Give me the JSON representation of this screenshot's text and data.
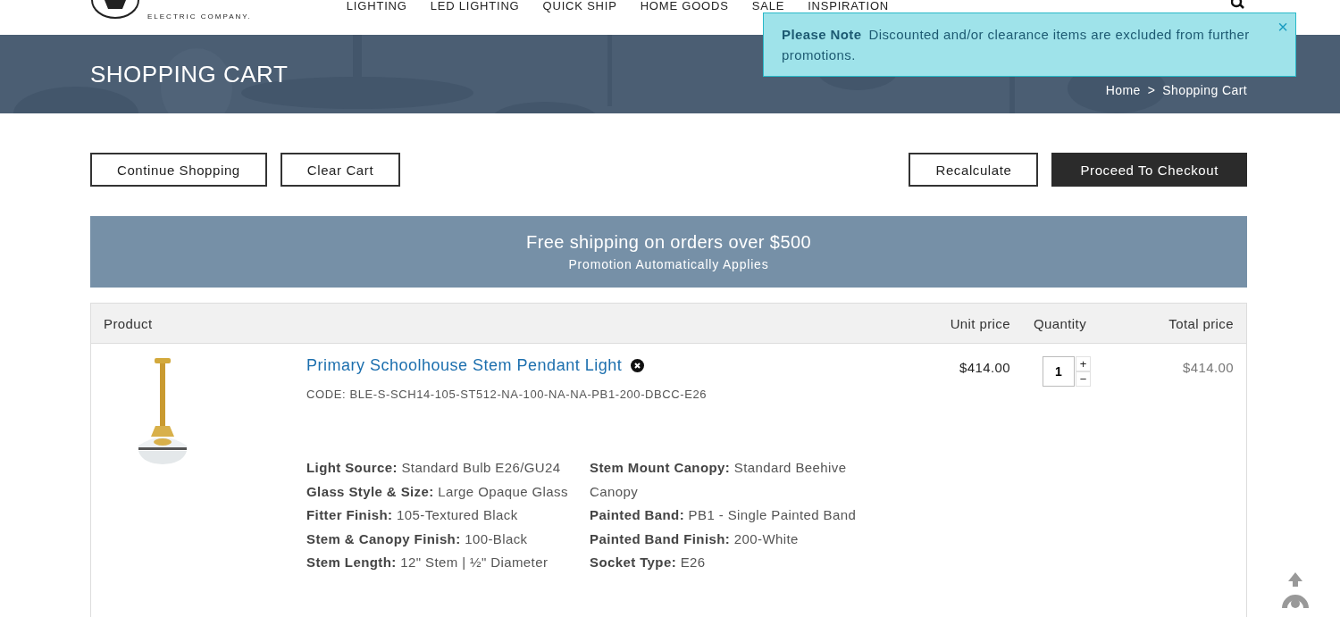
{
  "header": {
    "logo_tagline": "ELECTRIC COMPANY.",
    "nav": [
      {
        "label": "LIGHTING"
      },
      {
        "label": "LED LIGHTING"
      },
      {
        "label": "QUICK SHIP"
      },
      {
        "label": "HOME GOODS"
      },
      {
        "label": "SALE"
      },
      {
        "label": "INSPIRATION"
      }
    ]
  },
  "notice": {
    "title": "Please Note",
    "message": "Discounted and/or clearance items are excluded from further promotions.",
    "close": "×"
  },
  "banner": {
    "title": "SHOPPING CART",
    "breadcrumb": [
      "Home",
      "Shopping Cart"
    ],
    "separator": ">"
  },
  "actions_left": [
    {
      "label": "Continue Shopping",
      "kind": "outline"
    },
    {
      "label": "Clear Cart",
      "kind": "outline"
    }
  ],
  "actions_right": [
    {
      "label": "Recalculate",
      "kind": "outline"
    },
    {
      "label": "Proceed To Checkout",
      "kind": "primary"
    }
  ],
  "promo": {
    "headline": "Free shipping on orders over $500",
    "subline": "Promotion Automatically Applies"
  },
  "cart": {
    "columns": [
      "Product",
      "Unit price",
      "Quantity",
      "Total price"
    ],
    "items": [
      {
        "kind": "picture",
        "name": "Primary Schoolhouse Stem Pendant Light",
        "code": "CODE: BLE-S-SCH14-105-ST512-NA-100-NA-NA-PB1-200-DBCC-E26",
        "unit_price": "$414.00",
        "quantity": "1",
        "increment": "+",
        "decrement": "−",
        "total": "$414.00",
        "options_left": [
          "**Light Source:** Standard Bulb E26/GU24",
          "**Glass Style & Size:** Large Opaque Glass",
          "**Fitter Finish:** 105-Textured Black",
          "**Stem & Canopy Finish:** 100-Black",
          "**Stem Length:** 12\" Stem | ½\" Diameter"
        ],
        "options_right": [
          "**Stem Mount Canopy:** Standard Beehive Canopy",
          "**Painted Band:** PB1 - Single Painted Band",
          "**Painted Band Finish:** 200-White",
          "**Socket Type:** E26"
        ]
      }
    ]
  }
}
